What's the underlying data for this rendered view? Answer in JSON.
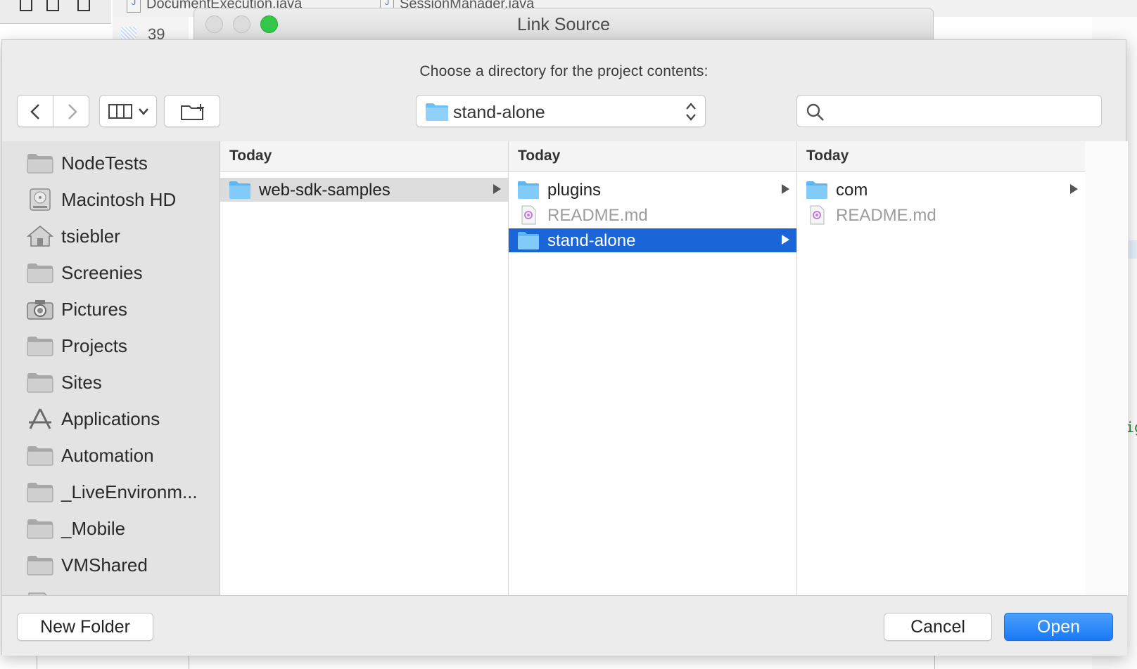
{
  "background_ide": {
    "tabs": [
      "DocumentExecution.java",
      "SessionManager.java"
    ],
    "line_number": "39"
  },
  "window": {
    "title": "Link Source"
  },
  "dialog": {
    "prompt": "Choose a directory for the project contents:",
    "path_popup": {
      "selected": "stand-alone"
    },
    "search": {
      "value": "",
      "placeholder": ""
    }
  },
  "sidebar": {
    "items": [
      {
        "label": "NodeTests",
        "icon": "folder-icon"
      },
      {
        "label": "Macintosh HD",
        "icon": "hard-drive-icon"
      },
      {
        "label": "tsiebler",
        "icon": "home-icon"
      },
      {
        "label": "Screenies",
        "icon": "folder-icon"
      },
      {
        "label": "Pictures",
        "icon": "camera-icon"
      },
      {
        "label": "Projects",
        "icon": "folder-icon"
      },
      {
        "label": "Sites",
        "icon": "folder-icon"
      },
      {
        "label": "Applications",
        "icon": "applications-icon"
      },
      {
        "label": "Automation",
        "icon": "folder-icon"
      },
      {
        "label": "_LiveEnvironm...",
        "icon": "folder-icon"
      },
      {
        "label": "_Mobile",
        "icon": "folder-icon"
      },
      {
        "label": "VMShared",
        "icon": "folder-icon"
      }
    ]
  },
  "columns": [
    {
      "header": "Today",
      "rows": [
        {
          "name": "web-sdk-samples",
          "kind": "folder",
          "state": "selected-inactive",
          "has_children": true
        }
      ]
    },
    {
      "header": "Today",
      "rows": [
        {
          "name": "plugins",
          "kind": "folder",
          "state": "normal",
          "has_children": true
        },
        {
          "name": "README.md",
          "kind": "file",
          "state": "disabled",
          "has_children": false
        },
        {
          "name": "stand-alone",
          "kind": "folder",
          "state": "selected",
          "has_children": true
        }
      ]
    },
    {
      "header": "Today",
      "rows": [
        {
          "name": "com",
          "kind": "folder",
          "state": "normal",
          "has_children": true
        },
        {
          "name": "README.md",
          "kind": "file",
          "state": "disabled",
          "has_children": false
        }
      ]
    }
  ],
  "footer": {
    "new_folder_label": "New Folder",
    "cancel_label": "Cancel",
    "open_label": "Open"
  },
  "colors": {
    "selection_blue": "#1a66d9",
    "folder_blue": "#6cc0f5",
    "traffic_green": "#34c84a"
  }
}
